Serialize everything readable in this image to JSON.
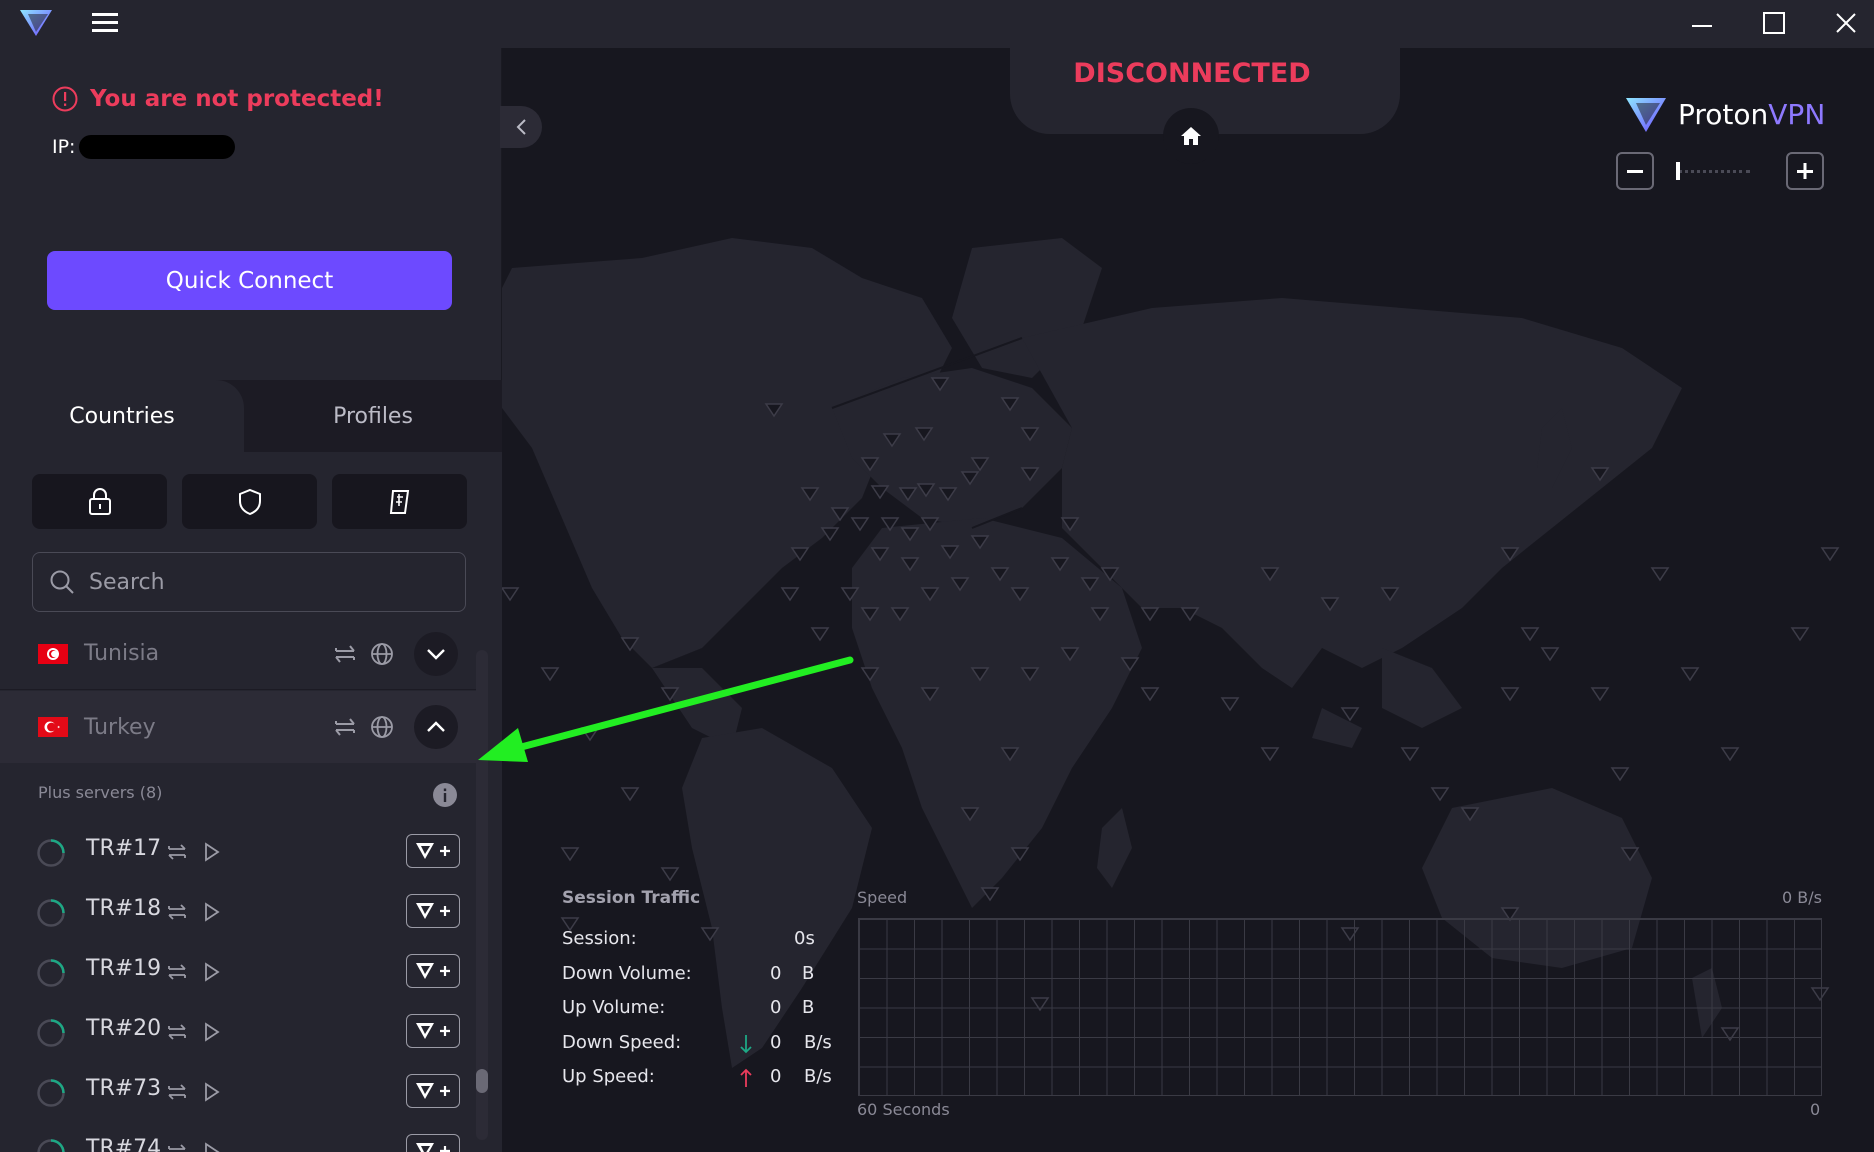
{
  "app": {
    "name": "ProtonVPN"
  },
  "titlebar": {
    "logo_icon": "proton-vpn-logo-icon",
    "menu_icon": "hamburger-menu-icon",
    "window_controls": [
      "minimize-icon",
      "maximize-icon",
      "close-icon"
    ]
  },
  "protection": {
    "warning": "You are not protected!",
    "ip_label": "IP:"
  },
  "quick_connect": {
    "label": "Quick Connect"
  },
  "tabs": [
    {
      "label": "Countries",
      "active": true
    },
    {
      "label": "Profiles",
      "active": false
    }
  ],
  "feature_filters": [
    {
      "icon": "lock-icon"
    },
    {
      "icon": "shield-icon"
    },
    {
      "icon": "p2p-tag-icon"
    }
  ],
  "search": {
    "placeholder": "Search",
    "value": ""
  },
  "countries": [
    {
      "name": "Tunisia",
      "expanded": false
    },
    {
      "name": "Turkey",
      "expanded": true
    }
  ],
  "plus_servers": {
    "header": "Plus servers (8)",
    "servers": [
      {
        "name": "TR#17"
      },
      {
        "name": "TR#18"
      },
      {
        "name": "TR#19"
      },
      {
        "name": "TR#20"
      },
      {
        "name": "TR#73"
      },
      {
        "name": "TR#74"
      }
    ]
  },
  "map": {
    "status": "DISCONNECTED",
    "brand_proton": "Proton",
    "brand_vpn": "VPN",
    "zoom_level": 0
  },
  "session_traffic": {
    "title": "Session Traffic",
    "rows": [
      {
        "label": "Session:",
        "value": "0s",
        "unit": ""
      },
      {
        "label": "Down Volume:",
        "value": "0",
        "unit": "B"
      },
      {
        "label": "Up Volume:",
        "value": "0",
        "unit": "B"
      },
      {
        "label": "Down Speed:",
        "value": "0",
        "unit": "B/s"
      },
      {
        "label": "Up Speed:",
        "value": "0",
        "unit": "B/s"
      }
    ]
  },
  "speed_graph": {
    "label": "Speed",
    "max_label": "0  B/s",
    "x_left_label": "60 Seconds",
    "x_right_label": "0"
  },
  "colors": {
    "accent": "#6d4aff",
    "danger": "#ec3c5c",
    "annotation_arrow": "#22ee22",
    "down_arrow": "#1ea885",
    "up_arrow": "#ec3c5c"
  }
}
